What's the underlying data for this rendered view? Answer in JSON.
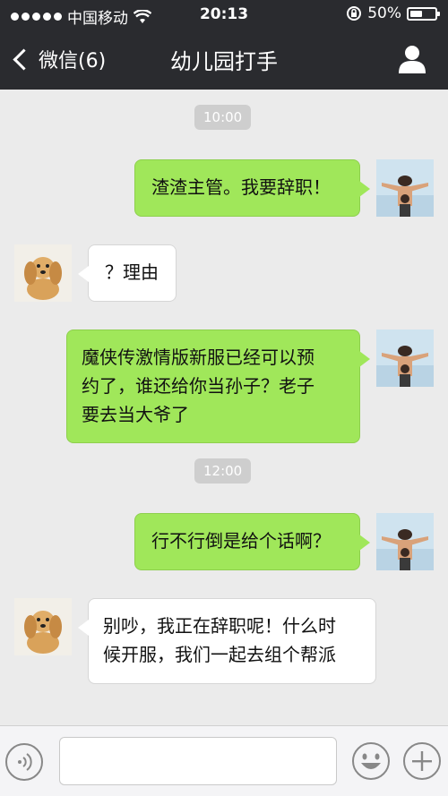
{
  "status_bar": {
    "carrier": "中国移动",
    "time": "20:13",
    "battery": "50%",
    "battery_level": 0.5
  },
  "nav": {
    "back_label": "微信(6)",
    "title": "幼儿园打手"
  },
  "messages": [
    {
      "type": "time",
      "text": "10:00"
    },
    {
      "type": "msg",
      "side": "right",
      "avatar": "one-piece-avatar",
      "text": "渣渣主管。我要辞职！"
    },
    {
      "type": "msg",
      "side": "left",
      "avatar": "puppy-avatar",
      "text": "？理由"
    },
    {
      "type": "msg",
      "side": "right",
      "avatar": "one-piece-avatar",
      "lines": [
        "魔侠传激情版新服已经可以预",
        "约了，谁还给你当孙子？老子",
        "要去当大爷了"
      ]
    },
    {
      "type": "time",
      "text": "12:00"
    },
    {
      "type": "msg",
      "side": "right",
      "avatar": "one-piece-avatar",
      "text": "行不行倒是给个话啊？"
    },
    {
      "type": "msg",
      "side": "left",
      "avatar": "puppy-avatar",
      "lines": [
        "别吵，我正在辞职呢！什么时",
        "候开服，我们一起去组个帮派"
      ]
    }
  ],
  "input_bar": {
    "placeholder": ""
  },
  "colors": {
    "header_bg": "#2a2b2f",
    "chat_bg": "#ebebeb",
    "bubble_right": "#a0e75a",
    "bubble_left": "#ffffff",
    "time_badge": "#cecece"
  }
}
